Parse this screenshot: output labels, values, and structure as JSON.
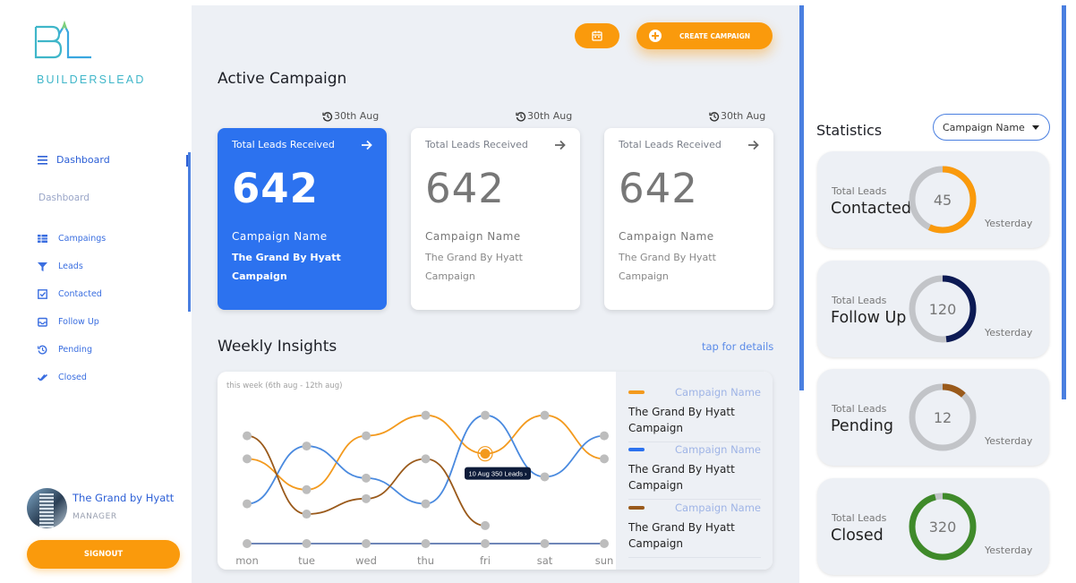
{
  "brand": {
    "name": "BUILDERSLEAD"
  },
  "sidebar": {
    "active_item": "Dashboard",
    "section_heading": "Dashboard",
    "items": [
      {
        "label": "Campaings",
        "icon": "table-icon"
      },
      {
        "label": "Leads",
        "icon": "filter-icon"
      },
      {
        "label": "Contacted",
        "icon": "checkbox-icon"
      },
      {
        "label": "Follow Up",
        "icon": "inbox-icon"
      },
      {
        "label": "Pending",
        "icon": "history-icon"
      },
      {
        "label": "Closed",
        "icon": "double-check-icon"
      }
    ],
    "profile": {
      "name": "The Grand by Hyatt",
      "role": "MANAGER"
    },
    "signout_label": "SIGNOUT"
  },
  "header": {
    "create_label": "CREATE CAMPAIGN"
  },
  "active_campaign": {
    "title": "Active Campaign",
    "cards": [
      {
        "date": "30th Aug",
        "label": "Total Leads Received",
        "value": "642",
        "campaign_label": "Campaign Name",
        "campaign": "The Grand By Hyatt Campaign"
      },
      {
        "date": "30th Aug",
        "label": "Total Leads Received",
        "value": "642",
        "campaign_label": "Campaign Name",
        "campaign": "The Grand By Hyatt Campaign"
      },
      {
        "date": "30th Aug",
        "label": "Total Leads Received",
        "value": "642",
        "campaign_label": "Campaign Name",
        "campaign": "The Grand By Hyatt Campaign"
      }
    ]
  },
  "weekly": {
    "title": "Weekly Insights",
    "link": "tap for details",
    "week_label": "this week (6th aug - 12th aug)",
    "tooltip": "10 Aug 350 Leads",
    "legend": [
      {
        "name": "Campaign Name",
        "desc": "The Grand By Hyatt Campaign",
        "color": "#f39a1e"
      },
      {
        "name": "Campaign Name",
        "desc": "The Grand By Hyatt Campaign",
        "color": "#2c72ef"
      },
      {
        "name": "Campaign Name",
        "desc": "The Grand By Hyatt Campaign",
        "color": "#9a5a1b"
      }
    ]
  },
  "chart_data": {
    "type": "line",
    "categories": [
      "mon",
      "tue",
      "wed",
      "thu",
      "fri",
      "sat",
      "sun"
    ],
    "ylim": [
      0,
      600
    ],
    "grid": false,
    "series": [
      {
        "color": "#f39a1e",
        "values": [
          330,
          210,
          420,
          500,
          350,
          500,
          330
        ]
      },
      {
        "color": "#4a8adf",
        "values": [
          155,
          380,
          255,
          155,
          500,
          260,
          420
        ]
      },
      {
        "color": "#9a5a1b",
        "values": [
          420,
          115,
          175,
          330,
          70,
          null,
          null
        ]
      },
      {
        "color": "#6f86b8",
        "values": [
          0,
          0,
          0,
          0,
          0,
          0,
          0
        ]
      }
    ]
  },
  "statistics": {
    "title": "Statistics",
    "filter": "Campaign Name",
    "cards": [
      {
        "small": "Total Leads",
        "big": "Contacted",
        "value": "45",
        "fraction": 0.57,
        "color": "#fa9a0c",
        "note": "Yesterday"
      },
      {
        "small": "Total Leads",
        "big": "Follow Up",
        "value": "120",
        "fraction": 0.48,
        "color": "#0c1a54",
        "note": "Yesterday"
      },
      {
        "small": "Total Leads",
        "big": "Pending",
        "value": "12",
        "fraction": 0.12,
        "color": "#9a5a1b",
        "note": "Yesterday"
      },
      {
        "small": "Total Leads",
        "big": "Closed",
        "value": "320",
        "fraction": 0.96,
        "color": "#3f8a2a",
        "note": "Yesterday"
      }
    ]
  }
}
